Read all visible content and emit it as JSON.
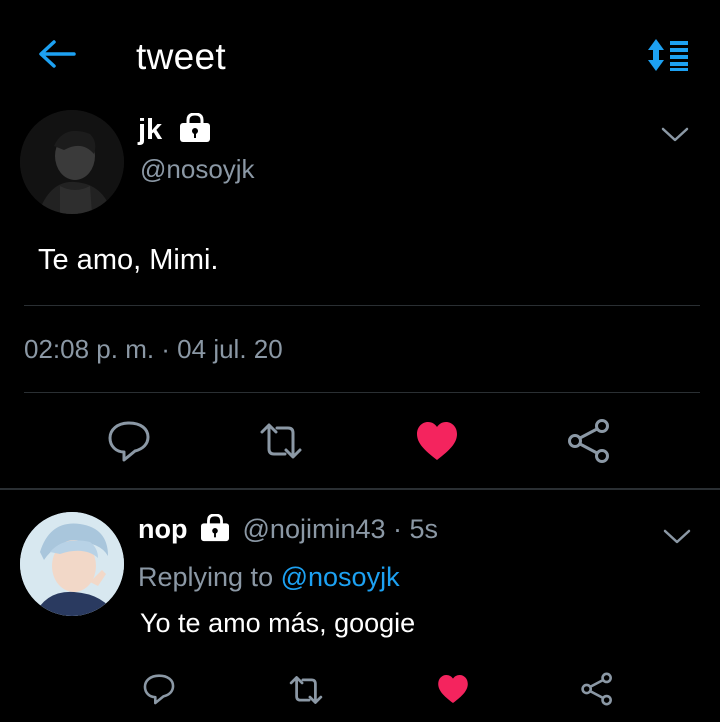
{
  "header": {
    "title": "tweet",
    "back_icon": "back-arrow-icon",
    "sort_icon": "sort-icon",
    "accent": "#1da1f2"
  },
  "tweet": {
    "name": "jk",
    "handle": "@nosoyjk",
    "text": "Te amo, Mimi.",
    "timestamp": "02:08 p. m. · 04 jul. 20",
    "liked": true,
    "like_color": "#f4245e"
  },
  "reply": {
    "name": "nop",
    "handle": "@nojimin43",
    "time": "· 5s",
    "replying_prefix": "Replying to",
    "replying_to": "@nosoyjk",
    "text": "Yo te amo más, googie",
    "liked": true
  },
  "colors": {
    "background": "#000000",
    "secondary_text": "#8b98a5",
    "divider": "#2a2f33"
  }
}
